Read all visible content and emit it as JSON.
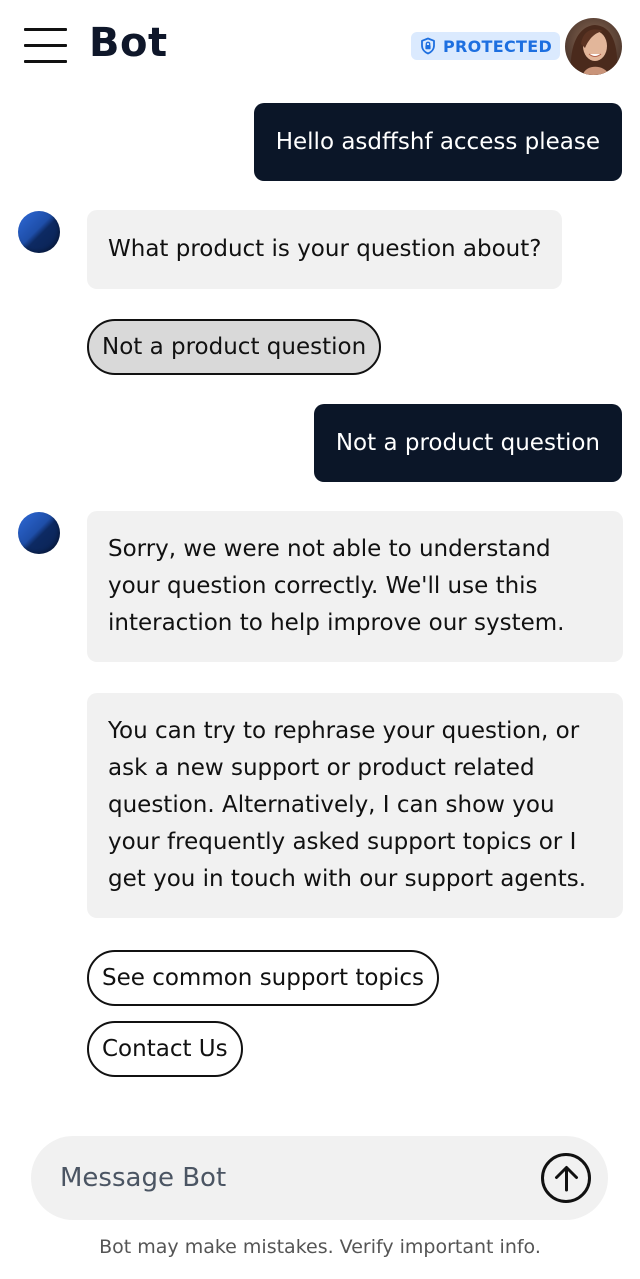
{
  "header": {
    "title": "Bot",
    "badge_label": "PROTECTED",
    "badge_icon": "shield-icon",
    "menu_icon": "hamburger-menu-icon",
    "avatar": "user-avatar"
  },
  "messages": [
    {
      "role": "user",
      "text": "Hello asdffshf access please"
    },
    {
      "role": "bot",
      "text": "What product is your question about?"
    },
    {
      "role": "user",
      "text": "Not a product question"
    },
    {
      "role": "bot",
      "text": "Sorry, we were not able to understand your question correctly. We'll use this interaction to help improve our system."
    },
    {
      "role": "bot",
      "text": "You can try to rephrase your question, or ask a new support or product related question. Alternatively, I can show you your frequently asked support topics or I get you in touch with our support agents."
    }
  ],
  "quick_replies_1": [
    {
      "label": "Not a product question",
      "selected": true
    }
  ],
  "quick_replies_2": [
    {
      "label": "See common support topics"
    },
    {
      "label": "Contact Us"
    }
  ],
  "composer": {
    "placeholder": "Message Bot",
    "send_icon": "arrow-up-icon"
  },
  "disclaimer": "Bot may make mistakes. Verify important info.",
  "colors": {
    "user_bubble": "#0b1628",
    "bot_bubble": "#f1f1f1",
    "badge_bg": "#dbeafe",
    "badge_text": "#1d6fe0",
    "selected_chip": "#d9d9d9"
  }
}
